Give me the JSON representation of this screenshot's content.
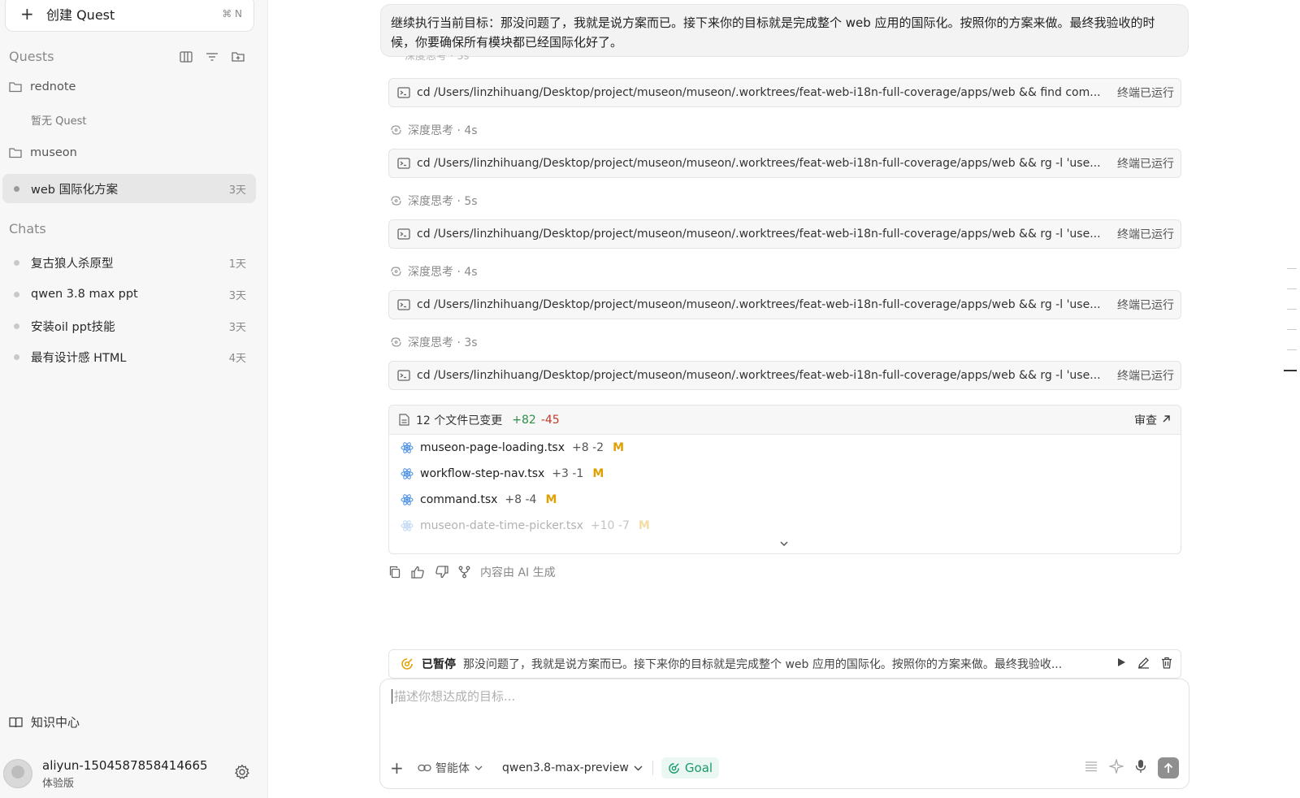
{
  "sidebar": {
    "new_quest": {
      "label": "创建 Quest",
      "shortcut": "⌘ N"
    },
    "quests_title": "Quests",
    "folders": [
      {
        "name": "rednote",
        "empty_note": "暂无 Quest"
      },
      {
        "name": "museon"
      }
    ],
    "quest_items": [
      {
        "label": "web 国际化方案",
        "age": "3天",
        "active": true
      }
    ],
    "chats_title": "Chats",
    "chats": [
      {
        "label": "复古狼人杀原型",
        "age": "1天"
      },
      {
        "label": "qwen 3.8 max ppt",
        "age": "3天"
      },
      {
        "label": "安装oil ppt技能",
        "age": "3天"
      },
      {
        "label": "最有设计感 HTML",
        "age": "4天"
      }
    ],
    "knowledge_center": "知识中心",
    "user": {
      "name": "aliyun-1504587858414665",
      "plan": "体验版"
    }
  },
  "main": {
    "user_message": "继续执行当前目标：那没问题了，我就是说方案而已。接下来你的目标就是完成整个 web 应用的国际化。按照你的方案来做。最终我验收的时候，你要确保所有模块都已经国际化好了。",
    "ghost_line": "深度思考 · 3s",
    "commands": [
      {
        "text": "cd /Users/linzhihuang/Desktop/project/museon/museon/.worktrees/feat-web-i18n-full-coverage/apps/web && find com...",
        "status": "终端已运行"
      },
      {
        "text": "cd /Users/linzhihuang/Desktop/project/museon/museon/.worktrees/feat-web-i18n-full-coverage/apps/web && rg -l 'use...",
        "status": "终端已运行"
      },
      {
        "text": "cd /Users/linzhihuang/Desktop/project/museon/museon/.worktrees/feat-web-i18n-full-coverage/apps/web && rg -l 'use...",
        "status": "终端已运行"
      },
      {
        "text": "cd /Users/linzhihuang/Desktop/project/museon/museon/.worktrees/feat-web-i18n-full-coverage/apps/web && rg -l 'use...",
        "status": "终端已运行"
      },
      {
        "text": "cd /Users/linzhihuang/Desktop/project/museon/museon/.worktrees/feat-web-i18n-full-coverage/apps/web && rg -l 'use...",
        "status": "终端已运行"
      }
    ],
    "thinking": [
      {
        "label": "深度思考 · 4s"
      },
      {
        "label": "深度思考 · 5s"
      },
      {
        "label": "深度思考 · 4s"
      },
      {
        "label": "深度思考 · 3s"
      }
    ],
    "changes": {
      "summary": "12 个文件已变更",
      "additions": "+82",
      "deletions": "-45",
      "review_label": "审查",
      "files": [
        {
          "name": "museon-page-loading.tsx",
          "stat": "+8 -2",
          "mod": "M"
        },
        {
          "name": "workflow-step-nav.tsx",
          "stat": "+3 -1",
          "mod": "M"
        },
        {
          "name": "command.tsx",
          "stat": "+8 -4",
          "mod": "M"
        },
        {
          "name": "museon-date-time-picker.tsx",
          "stat": "+10 -7",
          "mod": "M"
        }
      ]
    },
    "ai_note": "内容由 AI 生成",
    "paused": {
      "state": "已暂停",
      "text": "那没问题了，我就是说方案而已。接下来你的目标就是完成整个 web 应用的国际化。按照你的方案来做。最终我验收..."
    },
    "composer": {
      "placeholder": "描述你想达成的目标...",
      "agent_label": "智能体",
      "model_label": "qwen3.8-max-preview",
      "goal_label": "Goal"
    }
  },
  "colors": {
    "add": "#2f8f46",
    "del": "#c0392b",
    "modified": "#e0a100",
    "goal": "#1a9b6b"
  }
}
